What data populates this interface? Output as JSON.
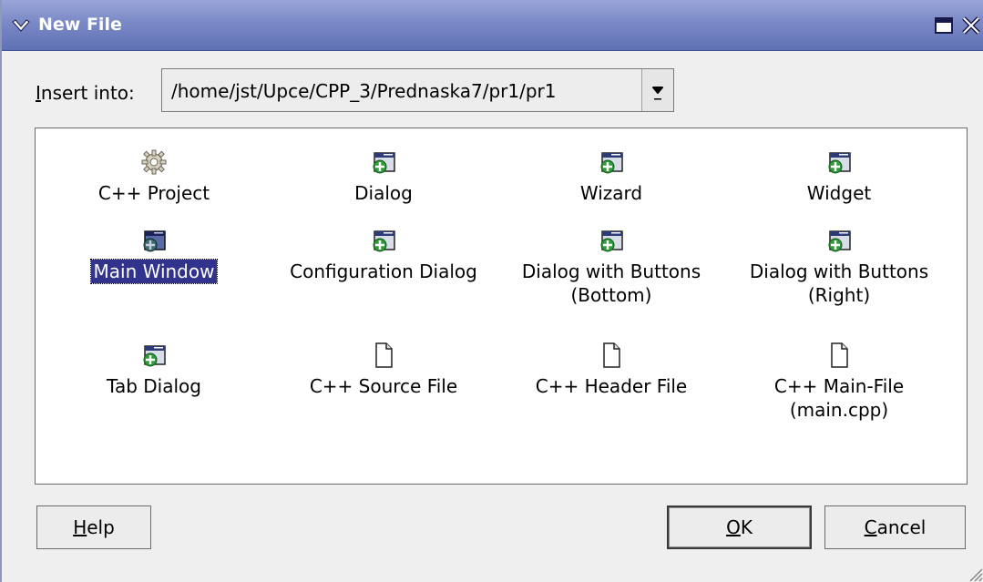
{
  "window": {
    "title": "New File"
  },
  "insert": {
    "label": "Insert into:",
    "path": "/home/jst/Upce/CPP_3/Prednaska7/pr1/pr1"
  },
  "items": [
    {
      "label": "C++ Project",
      "icon": "gear-icon"
    },
    {
      "label": "Dialog",
      "icon": "window-add-icon"
    },
    {
      "label": "Wizard",
      "icon": "window-add-icon"
    },
    {
      "label": "Widget",
      "icon": "window-add-icon"
    },
    {
      "label": "Main Window",
      "icon": "window-add-icon",
      "selected": true
    },
    {
      "label": "Configuration Dialog",
      "icon": "window-add-icon"
    },
    {
      "label": "Dialog with Buttons\n(Bottom)",
      "icon": "window-add-icon"
    },
    {
      "label": "Dialog with Buttons\n(Right)",
      "icon": "window-add-icon"
    },
    {
      "label": "Tab Dialog",
      "icon": "window-add-icon"
    },
    {
      "label": "C++ Source File",
      "icon": "document-icon"
    },
    {
      "label": "C++ Header File",
      "icon": "document-icon"
    },
    {
      "label": "C++ Main-File\n(main.cpp)",
      "icon": "document-icon"
    }
  ],
  "buttons": {
    "help": "Help",
    "ok": "OK",
    "cancel": "Cancel"
  },
  "colors": {
    "titlebar": "#7d8cc8",
    "selection": "#31338c"
  }
}
